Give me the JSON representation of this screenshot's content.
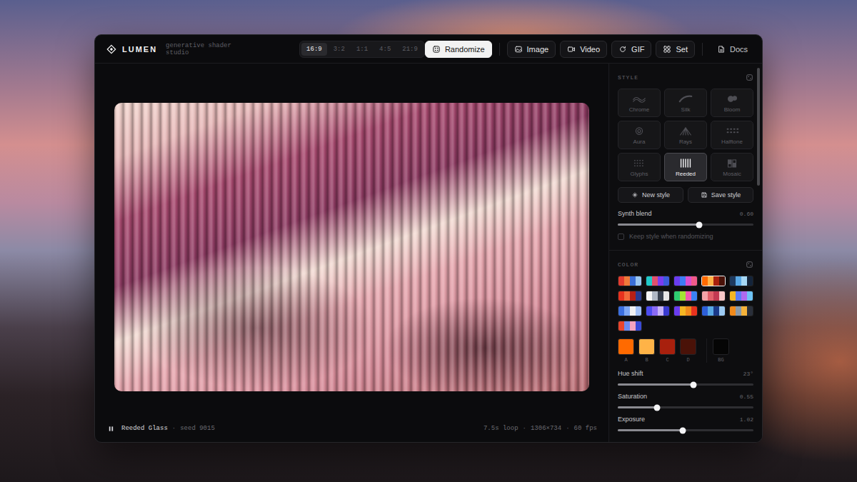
{
  "app": {
    "name": "LUMEN",
    "tagline": "generative shader studio"
  },
  "aspect_tabs": [
    {
      "label": "16:9",
      "selected": true
    },
    {
      "label": "3:2",
      "selected": false
    },
    {
      "label": "1:1",
      "selected": false
    },
    {
      "label": "4:5",
      "selected": false
    },
    {
      "label": "21:9",
      "selected": false
    }
  ],
  "toolbar": [
    {
      "label": "Randomize",
      "primary": true
    },
    {
      "label": "Image",
      "primary": false
    },
    {
      "label": "Video",
      "primary": false
    },
    {
      "label": "GIF",
      "primary": false
    },
    {
      "label": "Set",
      "primary": false
    },
    {
      "label": "Docs",
      "primary": false
    }
  ],
  "canvas": {
    "playing": true,
    "title": "Reeded Glass",
    "separator": "·",
    "seed": "seed 9015",
    "info": [
      "7.5s loop",
      "1306×734",
      "60 fps"
    ]
  },
  "style": {
    "heading": "STYLE",
    "items": [
      {
        "label": "Chrome",
        "selected": false
      },
      {
        "label": "Silk",
        "selected": false
      },
      {
        "label": "Bloom",
        "selected": false
      },
      {
        "label": "Aura",
        "selected": false
      },
      {
        "label": "Rays",
        "selected": false
      },
      {
        "label": "Halftone",
        "selected": false
      },
      {
        "label": "Glyphs",
        "selected": false
      },
      {
        "label": "Reeded",
        "selected": true
      },
      {
        "label": "Mosaic",
        "selected": false
      }
    ],
    "actions": [
      "New style",
      "Save style"
    ],
    "slider": {
      "label": "Synth blend",
      "reading": "0.60",
      "level": 0.6
    },
    "checkbox": {
      "label": "Keep style when randomizing",
      "checked": false
    }
  },
  "color": {
    "heading": "COLOR",
    "palettes": [
      {
        "colors": [
          "#e33b2e",
          "#f07a3a",
          "#3a6fd8",
          "#9cc8f2"
        ],
        "selected": false
      },
      {
        "colors": [
          "#1fc9c9",
          "#e0506b",
          "#7a3cf0",
          "#3b5bdb"
        ],
        "selected": false
      },
      {
        "colors": [
          "#6a3cf0",
          "#3d7bf5",
          "#d94fd0",
          "#f05a8a"
        ],
        "selected": false
      },
      {
        "colors": [
          "#ff6a00",
          "#ffb347",
          "#a8200d",
          "#4a1208"
        ],
        "selected": true
      },
      {
        "colors": [
          "#1e3a5f",
          "#5aa9e6",
          "#a6d8f5",
          "#14243a"
        ],
        "selected": false
      },
      {
        "colors": [
          "#e8321e",
          "#f26a3a",
          "#b81f14",
          "#2a3a8f"
        ],
        "selected": false
      },
      {
        "colors": [
          "#f5f5f5",
          "#b0b8c4",
          "#3a4250",
          "#e8e8e8"
        ],
        "selected": false
      },
      {
        "colors": [
          "#2ecc71",
          "#a3e635",
          "#f05ab0",
          "#3b82f6"
        ],
        "selected": false
      },
      {
        "colors": [
          "#f4a3a8",
          "#e0606a",
          "#c23a52",
          "#f7c7c7"
        ],
        "selected": false
      },
      {
        "colors": [
          "#f5b623",
          "#5b7cf5",
          "#b06af0",
          "#6ec3f5"
        ],
        "selected": false
      },
      {
        "colors": [
          "#3b6fe0",
          "#7da7f5",
          "#f2f2f2",
          "#a3c1f7"
        ],
        "selected": false
      },
      {
        "colors": [
          "#4c4cf0",
          "#8a6af5",
          "#c7b3f7",
          "#3a3ad0"
        ],
        "selected": false
      },
      {
        "colors": [
          "#6a3cf0",
          "#f5b623",
          "#f08a1c",
          "#e8321e"
        ],
        "selected": false
      },
      {
        "colors": [
          "#2d5fd8",
          "#5aa9e6",
          "#1a3a8a",
          "#9ccaf2"
        ],
        "selected": false
      },
      {
        "colors": [
          "#f08a1c",
          "#8a9aaa",
          "#f5b23a",
          "#2a2f3a"
        ],
        "selected": false
      },
      {
        "colors": [
          "#e8452c",
          "#6a8af0",
          "#f5a3c0",
          "#3a4ad8"
        ],
        "selected": false
      }
    ],
    "chips": [
      {
        "label": "A",
        "color": "#ff6a00"
      },
      {
        "label": "B",
        "color": "#ffb347"
      },
      {
        "label": "C",
        "color": "#a8200d"
      },
      {
        "label": "D",
        "color": "#4a1208"
      },
      {
        "label": "BG",
        "color": "#050505"
      }
    ],
    "sliders": [
      {
        "label": "Hue shift",
        "reading": "23°",
        "level": 0.56
      },
      {
        "label": "Saturation",
        "reading": "0.55",
        "level": 0.29
      },
      {
        "label": "Exposure",
        "reading": "1.02",
        "level": 0.48
      }
    ]
  }
}
